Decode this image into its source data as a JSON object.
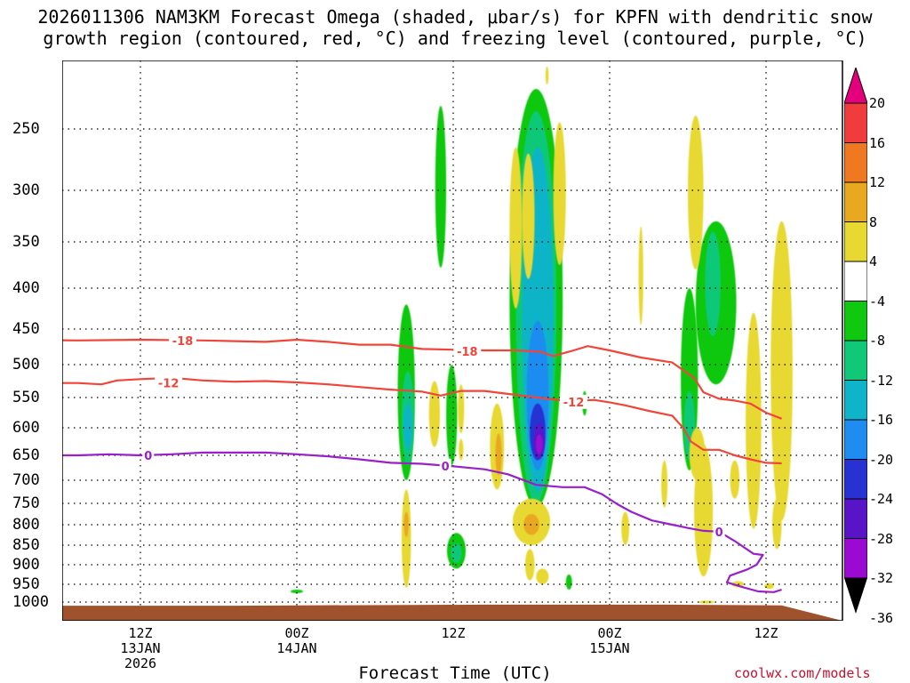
{
  "title_line1": "2026011306 NAM3KM Forecast Omega (shaded, μbar/s) for KPFN with dendritic snow",
  "title_line2": "growth region (contoured, red, °C) and freezing level (contoured, purple, °C)",
  "credit": "coolwx.com/models",
  "colors": {
    "dgz": "#f2453a",
    "freezing": "#9a1fc8",
    "ground": "#a0522d",
    "grid": "#000000"
  },
  "chart_data": {
    "type": "heatmap",
    "title": "2026011306 NAM3KM Forecast Omega (shaded, μbar/s) for KPFN with dendritic snow growth region (contoured, red, °C) and freezing level (contoured, purple, °C)",
    "xlabel": "Forecast Time (UTC)",
    "ylabel": "",
    "x_range_forecast_hours": [
      -3,
      47
    ],
    "y_scale": "pressure (log-like)",
    "y_ticks": [
      250,
      300,
      350,
      400,
      450,
      500,
      550,
      600,
      650,
      700,
      750,
      800,
      850,
      900,
      950,
      1000
    ],
    "x_ticks": [
      {
        "hour": 6,
        "lines": [
          "12Z",
          "13JAN",
          "2026"
        ]
      },
      {
        "hour": 16,
        "lines": [
          "00Z",
          "14JAN"
        ]
      },
      {
        "hour": 26,
        "lines": [
          "12Z"
        ]
      },
      {
        "hour": 36,
        "lines": [
          "00Z",
          "15JAN"
        ]
      },
      {
        "hour": 46,
        "lines": [
          "12Z"
        ]
      }
    ],
    "grid": true,
    "colorbar": {
      "unit": "μbar/s",
      "labels": [
        "20",
        "16",
        "12",
        "8",
        "4",
        "-4",
        "-8",
        "-12",
        "-16",
        "-20",
        "-24",
        "-28",
        "-32",
        "-36"
      ],
      "bins": [
        {
          "lo": 20,
          "hi": 24,
          "color": "#e4007c"
        },
        {
          "lo": 16,
          "hi": 20,
          "color": "#f03c3c"
        },
        {
          "lo": 12,
          "hi": 16,
          "color": "#f07820"
        },
        {
          "lo": 8,
          "hi": 12,
          "color": "#e8a820"
        },
        {
          "lo": 4,
          "hi": 8,
          "color": "#e8d832"
        },
        {
          "lo": -4,
          "hi": 4,
          "color": "#ffffff"
        },
        {
          "lo": -8,
          "hi": -4,
          "color": "#10c810"
        },
        {
          "lo": -12,
          "hi": -8,
          "color": "#10c878"
        },
        {
          "lo": -16,
          "hi": -12,
          "color": "#10b4c8"
        },
        {
          "lo": -20,
          "hi": -16,
          "color": "#1e8cf0"
        },
        {
          "lo": -24,
          "hi": -20,
          "color": "#2832d2"
        },
        {
          "lo": -28,
          "hi": -24,
          "color": "#5a14c8"
        },
        {
          "lo": -32,
          "hi": -28,
          "color": "#9a0ad2"
        },
        {
          "lo": -36,
          "hi": -32,
          "color": "#a0a0a0"
        }
      ]
    },
    "contours": [
      {
        "name": "-18",
        "label": "-18",
        "color": "#f2453a",
        "labels_at": [
          [
            8.7,
            466
          ],
          [
            26.9,
            481
          ]
        ],
        "points": [
          [
            -3,
            465
          ],
          [
            2,
            466
          ],
          [
            6,
            465
          ],
          [
            10,
            466
          ],
          [
            14,
            468
          ],
          [
            16,
            465
          ],
          [
            18,
            468
          ],
          [
            20,
            472
          ],
          [
            22,
            472
          ],
          [
            24,
            478
          ],
          [
            26,
            479
          ],
          [
            28,
            480
          ],
          [
            30,
            480
          ],
          [
            31.6,
            482
          ],
          [
            32.4,
            488
          ],
          [
            33.7,
            480
          ],
          [
            34.6,
            474
          ],
          [
            36,
            480
          ],
          [
            38,
            490
          ],
          [
            40,
            497
          ],
          [
            41.4,
            520
          ],
          [
            42,
            542
          ],
          [
            43,
            552
          ],
          [
            44,
            555
          ],
          [
            45,
            560
          ],
          [
            46,
            575
          ],
          [
            47,
            585
          ]
        ]
      },
      {
        "name": "-12",
        "label": "-12",
        "color": "#f2453a",
        "labels_at": [
          [
            7.8,
            528
          ],
          [
            33.7,
            557
          ]
        ],
        "points": [
          [
            -3,
            528
          ],
          [
            2,
            528
          ],
          [
            3.5,
            530
          ],
          [
            4.5,
            524
          ],
          [
            6,
            522
          ],
          [
            8,
            520
          ],
          [
            10,
            524
          ],
          [
            12,
            526
          ],
          [
            14,
            525
          ],
          [
            16,
            527
          ],
          [
            18,
            530
          ],
          [
            20,
            534
          ],
          [
            22,
            538
          ],
          [
            24,
            541
          ],
          [
            25.2,
            547
          ],
          [
            26.5,
            540
          ],
          [
            28,
            540
          ],
          [
            30,
            546
          ],
          [
            32,
            552
          ],
          [
            33.5,
            556
          ],
          [
            35,
            554
          ],
          [
            36,
            558
          ],
          [
            37,
            563
          ],
          [
            38.5,
            572
          ],
          [
            40,
            580
          ],
          [
            40.7,
            600
          ],
          [
            41.2,
            625
          ],
          [
            42,
            640
          ],
          [
            43,
            640
          ],
          [
            44,
            650
          ],
          [
            45,
            658
          ],
          [
            46,
            665
          ],
          [
            47,
            666
          ]
        ]
      },
      {
        "name": "0",
        "label": "0",
        "color": "#9a1fc8",
        "labels_at": [
          [
            6.5,
            650
          ],
          [
            25.5,
            671
          ],
          [
            43.0,
            817
          ]
        ],
        "points": [
          [
            -3,
            650
          ],
          [
            2,
            650
          ],
          [
            4,
            648
          ],
          [
            6,
            650
          ],
          [
            8,
            648
          ],
          [
            10,
            645
          ],
          [
            12,
            645
          ],
          [
            14,
            645
          ],
          [
            16,
            648
          ],
          [
            18,
            652
          ],
          [
            20,
            658
          ],
          [
            22,
            665
          ],
          [
            24,
            667
          ],
          [
            26,
            672
          ],
          [
            28,
            678
          ],
          [
            29.5,
            688
          ],
          [
            31.3,
            710
          ],
          [
            33,
            715
          ],
          [
            34.4,
            715
          ],
          [
            35.5,
            730
          ],
          [
            36.5,
            752
          ],
          [
            37.4,
            770
          ],
          [
            38.7,
            790
          ],
          [
            40,
            800
          ],
          [
            41,
            808
          ],
          [
            42,
            815
          ],
          [
            43.0,
            817
          ],
          [
            44,
            840
          ],
          [
            45.2,
            872
          ],
          [
            45.8,
            875
          ],
          [
            45.4,
            900
          ],
          [
            44.8,
            912
          ],
          [
            43.7,
            928
          ],
          [
            43.5,
            945
          ],
          [
            44.5,
            958
          ],
          [
            45.5,
            970
          ],
          [
            46.5,
            972
          ],
          [
            47,
            965
          ]
        ]
      }
    ],
    "regions": [
      {
        "x": 25.2,
        "y": 288,
        "rx": 0.35,
        "ry": 90,
        "value": -6
      },
      {
        "x": 31.3,
        "y": 460,
        "rx": 1.7,
        "ry": 300,
        "value": -6
      },
      {
        "x": 31.3,
        "y": 480,
        "rx": 1.3,
        "ry": 270,
        "value": -10
      },
      {
        "x": 31.4,
        "y": 495,
        "rx": 1.0,
        "ry": 230,
        "value": -14
      },
      {
        "x": 31.4,
        "y": 560,
        "rx": 0.7,
        "ry": 120,
        "value": -18
      },
      {
        "x": 31.4,
        "y": 610,
        "rx": 0.5,
        "ry": 50,
        "value": -22
      },
      {
        "x": 31.5,
        "y": 625,
        "rx": 0.35,
        "ry": 32,
        "value": -26
      },
      {
        "x": 31.5,
        "y": 630,
        "rx": 0.22,
        "ry": 18,
        "value": -30
      },
      {
        "x": 23.0,
        "y": 560,
        "rx": 0.55,
        "ry": 140,
        "value": -6
      },
      {
        "x": 23.1,
        "y": 590,
        "rx": 0.4,
        "ry": 80,
        "value": -10
      },
      {
        "x": 23.1,
        "y": 600,
        "rx": 0.28,
        "ry": 40,
        "value": -14
      },
      {
        "x": 25.9,
        "y": 585,
        "rx": 0.35,
        "ry": 85,
        "value": -6
      },
      {
        "x": 26.2,
        "y": 865,
        "rx": 0.6,
        "ry": 45,
        "value": -6
      },
      {
        "x": 26.2,
        "y": 870,
        "rx": 0.35,
        "ry": 25,
        "value": -10
      },
      {
        "x": 41.1,
        "y": 540,
        "rx": 0.55,
        "ry": 140,
        "value": -6
      },
      {
        "x": 41.1,
        "y": 600,
        "rx": 0.35,
        "ry": 60,
        "value": -10
      },
      {
        "x": 42.8,
        "y": 430,
        "rx": 1.3,
        "ry": 100,
        "value": -6
      },
      {
        "x": 42.6,
        "y": 400,
        "rx": 0.5,
        "ry": 60,
        "value": -10
      },
      {
        "x": 34.4,
        "y": 560,
        "rx": 0.15,
        "ry": 20,
        "value": -6
      },
      {
        "x": 33.4,
        "y": 945,
        "rx": 0.2,
        "ry": 20,
        "value": -6
      },
      {
        "x": 16.0,
        "y": 970,
        "rx": 0.4,
        "ry": 5,
        "value": -6
      },
      {
        "x": 30.0,
        "y": 345,
        "rx": 0.4,
        "ry": 80,
        "value": 6
      },
      {
        "x": 30.8,
        "y": 330,
        "rx": 0.4,
        "ry": 60,
        "value": 6
      },
      {
        "x": 32.8,
        "y": 305,
        "rx": 0.4,
        "ry": 70,
        "value": 6
      },
      {
        "x": 38.0,
        "y": 390,
        "rx": 0.15,
        "ry": 55,
        "value": 6
      },
      {
        "x": 41.5,
        "y": 300,
        "rx": 0.5,
        "ry": 80,
        "value": 6
      },
      {
        "x": 26.5,
        "y": 570,
        "rx": 0.2,
        "ry": 40,
        "value": 6
      },
      {
        "x": 24.8,
        "y": 580,
        "rx": 0.35,
        "ry": 55,
        "value": 6
      },
      {
        "x": 28.8,
        "y": 640,
        "rx": 0.45,
        "ry": 80,
        "value": 6
      },
      {
        "x": 28.9,
        "y": 650,
        "rx": 0.2,
        "ry": 40,
        "value": 10
      },
      {
        "x": 31.0,
        "y": 795,
        "rx": 1.2,
        "ry": 55,
        "value": 6
      },
      {
        "x": 31.0,
        "y": 800,
        "rx": 0.5,
        "ry": 25,
        "value": 10
      },
      {
        "x": 30.9,
        "y": 900,
        "rx": 0.3,
        "ry": 40,
        "value": 6
      },
      {
        "x": 31.7,
        "y": 930,
        "rx": 0.4,
        "ry": 20,
        "value": 6
      },
      {
        "x": 26.5,
        "y": 640,
        "rx": 0.15,
        "ry": 20,
        "value": 6
      },
      {
        "x": 23.0,
        "y": 840,
        "rx": 0.3,
        "ry": 120,
        "value": 6
      },
      {
        "x": 23.0,
        "y": 800,
        "rx": 0.15,
        "ry": 30,
        "value": 10
      },
      {
        "x": 37.0,
        "y": 810,
        "rx": 0.25,
        "ry": 40,
        "value": 6
      },
      {
        "x": 39.5,
        "y": 710,
        "rx": 0.2,
        "ry": 50,
        "value": 6
      },
      {
        "x": 42.0,
        "y": 780,
        "rx": 0.6,
        "ry": 150,
        "value": 6
      },
      {
        "x": 41.6,
        "y": 650,
        "rx": 0.5,
        "ry": 50,
        "value": 6
      },
      {
        "x": 44.0,
        "y": 700,
        "rx": 0.3,
        "ry": 40,
        "value": 6
      },
      {
        "x": 45.2,
        "y": 620,
        "rx": 0.5,
        "ry": 190,
        "value": 6
      },
      {
        "x": 46.7,
        "y": 800,
        "rx": 0.3,
        "ry": 60,
        "value": 6
      },
      {
        "x": 46.2,
        "y": 955,
        "rx": 0.3,
        "ry": 8,
        "value": 6
      },
      {
        "x": 44.2,
        "y": 950,
        "rx": 0.4,
        "ry": 8,
        "value": 6
      },
      {
        "x": 47.0,
        "y": 560,
        "rx": 0.7,
        "ry": 230,
        "value": 6
      },
      {
        "x": 47.0,
        "y": 440,
        "rx": 0.3,
        "ry": 80,
        "value": 6
      },
      {
        "x": 32.0,
        "y": 130,
        "rx": 0.1,
        "ry": 20,
        "value": 6
      },
      {
        "x": 42.2,
        "y": 1000,
        "rx": 0.5,
        "ry": 4,
        "value": 6
      }
    ],
    "ground_pressure": [
      [
        -3,
        1010
      ],
      [
        12,
        1010
      ],
      [
        16,
        1009
      ],
      [
        22,
        1008
      ],
      [
        28,
        1007
      ],
      [
        35,
        1007
      ],
      [
        40,
        1007
      ],
      [
        44,
        1008
      ],
      [
        47,
        1009
      ]
    ]
  }
}
